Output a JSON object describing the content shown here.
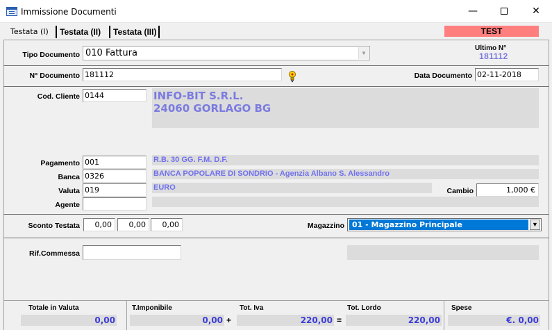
{
  "window": {
    "title": "Immissione Documenti"
  },
  "tabs": [
    {
      "label": "Testata (I)"
    },
    {
      "label": "Testata (II)"
    },
    {
      "label": "Testata (III)"
    }
  ],
  "badge": {
    "text": "TEST"
  },
  "header": {
    "tipo_documento_label": "Tipo Documento",
    "tipo_documento_value": "010 Fattura",
    "ultimo_label": "Ultimo N°",
    "ultimo_value": "181112",
    "numero_label": "N° Documento",
    "numero_value": "181112",
    "data_label": "Data Documento",
    "data_value": "02-11-2018"
  },
  "cliente": {
    "label": "Cod. Cliente",
    "code": "0144",
    "name": "INFO-BIT S.R.L.",
    "city": "24060 GORLAGO BG"
  },
  "pagamento": {
    "label": "Pagamento",
    "code": "001",
    "desc": "R.B. 30 GG. F.M. D.F."
  },
  "banca": {
    "label": "Banca",
    "code": "0326",
    "desc": "BANCA POPOLARE DI SONDRIO - Agenzia Albano S. Alessandro"
  },
  "valuta": {
    "label": "Valuta",
    "code": "019",
    "desc": "EURO"
  },
  "cambio": {
    "label": "Cambio",
    "value": "1,000 €"
  },
  "agente": {
    "label": "Agente",
    "code": "",
    "desc": ""
  },
  "sconto": {
    "label": "Sconto Testata",
    "values": [
      "0,00",
      "0,00",
      "0,00"
    ]
  },
  "magazzino": {
    "label": "Magazzino",
    "value": "01 - Magazzino Principale"
  },
  "commessa": {
    "label": "Rif.Commessa",
    "value": "",
    "desc": ""
  },
  "totals": {
    "valuta_label": "Totale in Valuta",
    "valuta_value": "0,00",
    "imponibile_label": "T.Imponibile",
    "imponibile_value": "0,00",
    "plus": "+",
    "iva_label": "Tot. Iva",
    "iva_value": "220,00",
    "equals": "=",
    "lordo_label": "Tot. Lordo",
    "lordo_value": "220,00",
    "spese_label": "Spese",
    "spese_value": "€. 0,00"
  },
  "colors": {
    "badge": "#ff7f7f",
    "readonly_text": "#7b7be0",
    "selection": "#0078d7"
  },
  "icons": [
    "app-window-icon",
    "minimize-icon",
    "maximize-icon",
    "close-icon",
    "chevron-down-icon",
    "lightbulb-icon"
  ]
}
